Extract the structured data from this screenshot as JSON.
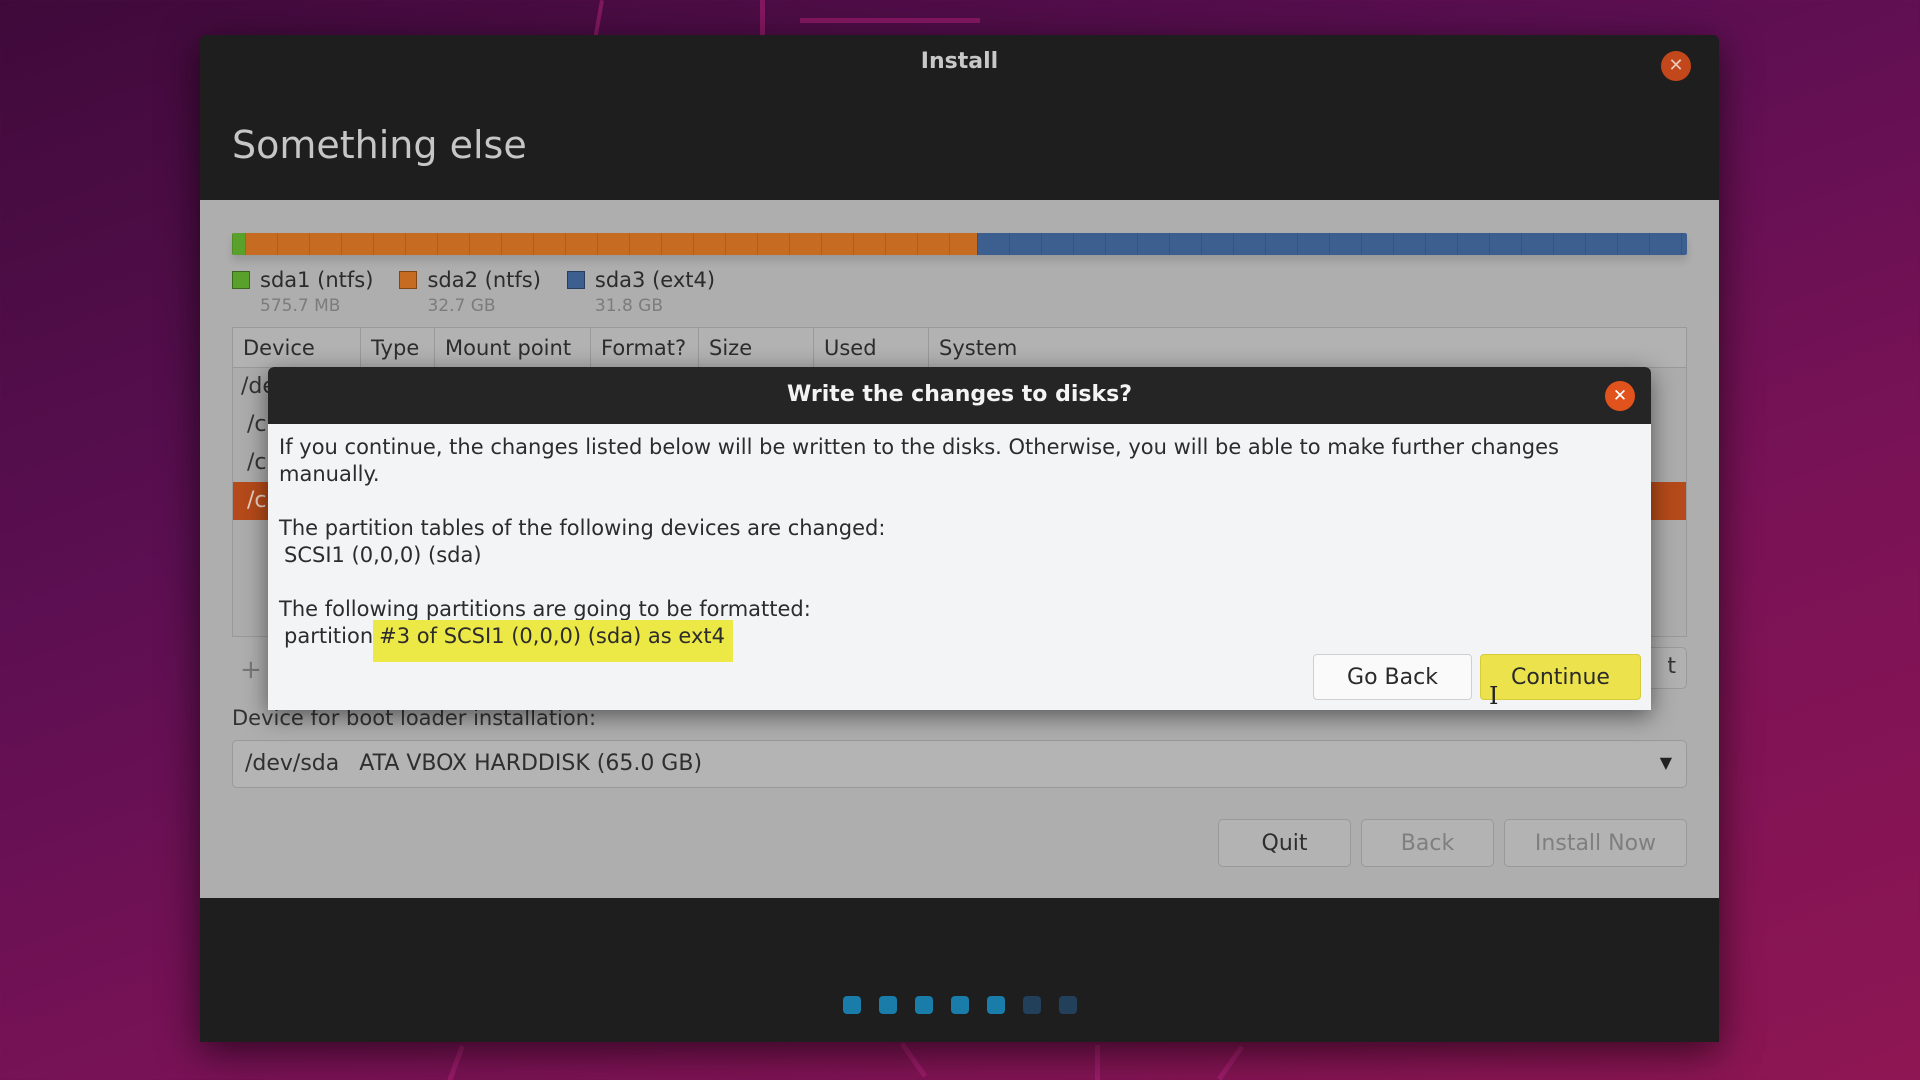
{
  "window": {
    "title": "Install",
    "close_icon": "close-icon",
    "page_title": "Something else"
  },
  "partitions": {
    "bar": [
      {
        "name": "sda1",
        "fraction": 0.009,
        "color": "#5aa12b"
      },
      {
        "name": "sda2",
        "fraction": 0.503,
        "color": "#c56c22"
      },
      {
        "name": "sda3",
        "fraction": 0.488,
        "color": "#3c5f8f"
      }
    ],
    "legend": [
      {
        "label": "sda1 (ntfs)",
        "size": "575.7 MB",
        "color": "#5aa12b"
      },
      {
        "label": "sda2 (ntfs)",
        "size": "32.7 GB",
        "color": "#c56c22"
      },
      {
        "label": "sda3 (ext4)",
        "size": "31.8 GB",
        "color": "#3c5f8f"
      }
    ]
  },
  "table": {
    "columns": [
      "Device",
      "Type",
      "Mount point",
      "Format?",
      "Size",
      "Used",
      "System"
    ],
    "rows_visible_prefix": [
      "/de",
      "/c",
      "/c",
      "/c"
    ],
    "selected_row": 3
  },
  "controls": {
    "add_label": "+",
    "partial_button_label": "t"
  },
  "boot_loader": {
    "label": "Device for boot loader installation:",
    "selected_device": "/dev/sda",
    "selected_desc": "ATA VBOX HARDDISK (65.0 GB)"
  },
  "nav": {
    "quit": "Quit",
    "back": "Back",
    "install_now": "Install Now"
  },
  "progress": {
    "total_steps": 7,
    "completed_steps": 5
  },
  "dialog": {
    "title": "Write the changes to disks?",
    "intro": "If you continue, the changes listed below will be written to the disks. Otherwise, you will be able to make further changes manually.",
    "tables_heading": "The partition tables of the following devices are changed:",
    "tables_device": "SCSI1 (0,0,0) (sda)",
    "format_heading": "The following partitions are going to be formatted:",
    "format_prefix": "partition",
    "format_item": "#3 of SCSI1 (0,0,0) (sda) as ext4",
    "highlight_color": "#ece846",
    "go_back": "Go Back",
    "continue": "Continue"
  }
}
